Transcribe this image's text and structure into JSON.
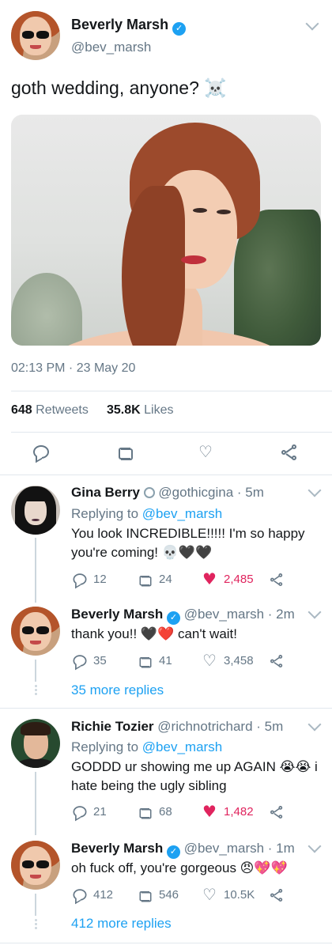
{
  "main_tweet": {
    "name": "Beverly Marsh",
    "handle": "@bev_marsh",
    "text": "goth wedding, anyone? ☠️",
    "timestamp": "02:13 PM · 23 May 20",
    "retweets_count": "648",
    "retweets_label": "Retweets",
    "likes_count": "35.8K",
    "likes_label": "Likes"
  },
  "replies": [
    {
      "name": "Gina Berry",
      "name_badge": "ring-icon",
      "handle": "@gothicgina",
      "time": "· 5m",
      "replying_prefix": "Replying to",
      "replying_to": "@bev_marsh",
      "text_line1": "You look INCREDIBLE!!!!! I'm so happy",
      "text_line2": "you're coming! 💀🖤🖤",
      "reply_count": "12",
      "retweet_count": "24",
      "like_count": "2,485",
      "liked": true
    },
    {
      "name": "Beverly Marsh",
      "handle": "@bev_marsh",
      "time": "· 2m",
      "text_line1": "thank you!! 🖤❤️ can't wait!",
      "reply_count": "35",
      "retweet_count": "41",
      "like_count": "3,458",
      "liked": false,
      "more_replies": "35 more replies"
    },
    {
      "name": "Richie Tozier",
      "handle": "@richnotrichard",
      "time": "· 5m",
      "replying_prefix": "Replying to",
      "replying_to": "@bev_marsh",
      "text_line1": "GODDD ur showing me up AGAIN 😭😭 i",
      "text_line2": "hate being the ugly sibling",
      "reply_count": "21",
      "retweet_count": "68",
      "like_count": "1,482",
      "liked": true
    },
    {
      "name": "Beverly Marsh",
      "handle": "@bev_marsh",
      "time": "· 1m",
      "text_line1": "oh fuck off, you're gorgeous 😠💖💖",
      "reply_count": "412",
      "retweet_count": "546",
      "like_count": "10.5K",
      "liked": false,
      "more_replies": "412 more replies"
    }
  ],
  "colors": {
    "link": "#1da1f2",
    "muted": "#657786",
    "like_red": "#e0245e",
    "divider": "#e1e8ed"
  }
}
